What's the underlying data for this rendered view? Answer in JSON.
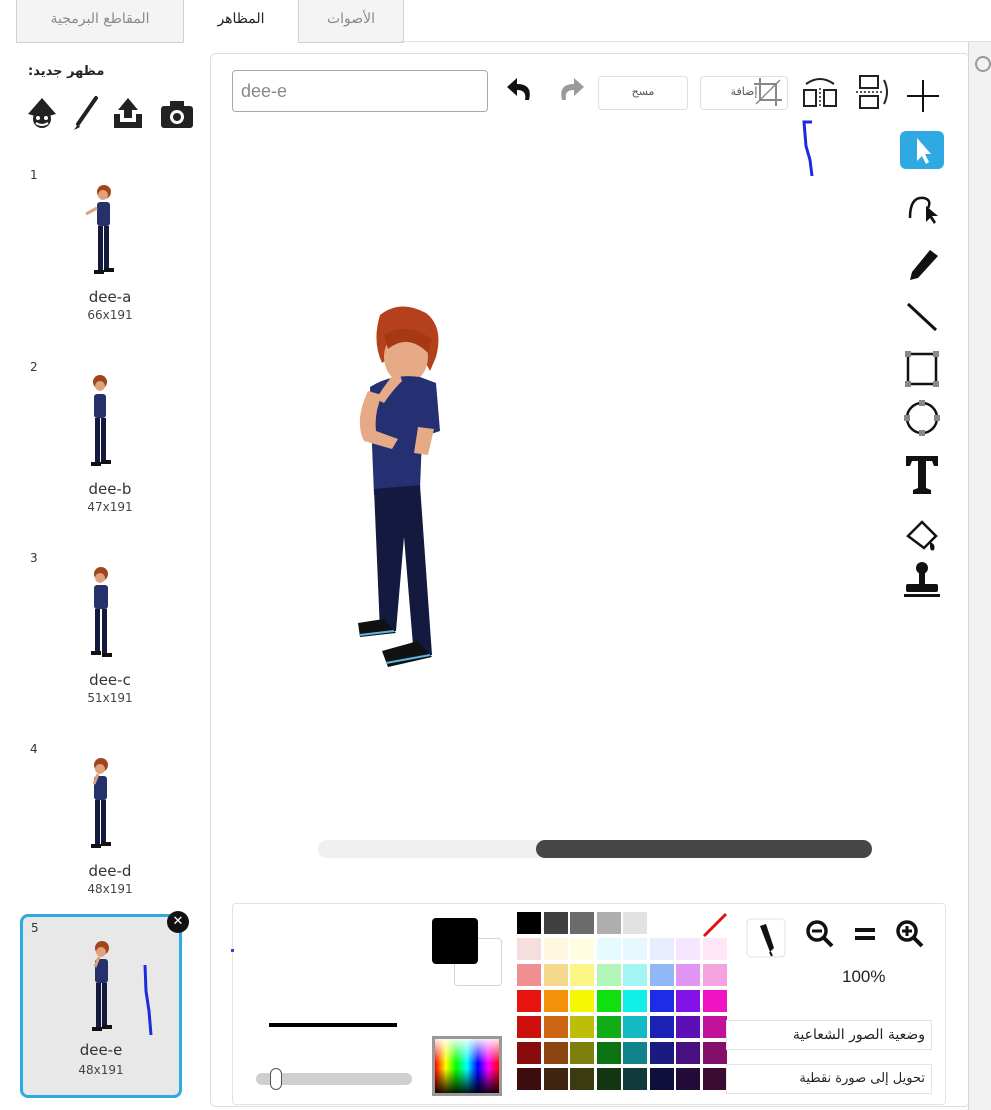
{
  "tabs": [
    {
      "label": "المقاطع البرمجية"
    },
    {
      "label": "المظاهر"
    },
    {
      "label": "الأصوات"
    }
  ],
  "new_costume": {
    "label": ":مظهر جديد",
    "icons": [
      "sprite-library-icon",
      "paint-brush-icon",
      "upload-icon",
      "camera-icon"
    ]
  },
  "costumes": [
    {
      "number": "1",
      "name": "dee-a",
      "size": "66x191"
    },
    {
      "number": "2",
      "name": "dee-b",
      "size": "47x191"
    },
    {
      "number": "3",
      "name": "dee-c",
      "size": "51x191"
    },
    {
      "number": "4",
      "name": "dee-d",
      "size": "48x191"
    },
    {
      "number": "5",
      "name": "dee-e",
      "size": "48x191",
      "selected": true
    }
  ],
  "editor": {
    "costume_name": "dee-e",
    "clear_label": "مسح",
    "add_label": "إضافة",
    "tools": [
      "select-arrow",
      "reshape",
      "pencil",
      "line",
      "rectangle",
      "ellipse",
      "text",
      "fill-bucket",
      "stamp"
    ]
  },
  "zoom": {
    "value": "100%"
  },
  "modes": {
    "bitmap_label": "وضعية الصور الشعاعية",
    "convert_label": "تحويل إلى صورة نقطية"
  },
  "colors": {
    "accent": "#2ea9e1",
    "primary_color": "#000000",
    "secondary_color": "#ffffff",
    "palette": [
      [
        "#000000",
        "#404040",
        "#6b6b6b",
        "#aeaeae",
        "#e2e2e2",
        "#ffffff",
        "#ffffff",
        "#ffffff"
      ],
      [
        "#f4dede",
        "#fff8e0",
        "#fffde0",
        "#e6fbff",
        "#e6f7ff",
        "#e8eeff",
        "#f6e6ff",
        "#ffe6f6"
      ],
      [
        "#ef8f8f",
        "#f4d98c",
        "#fbf684",
        "#b2f7b9",
        "#a3f5f4",
        "#92b7f6",
        "#e196f4",
        "#f5a3df"
      ],
      [
        "#e8140f",
        "#f3920a",
        "#f6f705",
        "#10e00d",
        "#12efe9",
        "#1d2ce7",
        "#8412e6",
        "#ef13c4"
      ],
      [
        "#cd0f0d",
        "#cb6513",
        "#bdbd0c",
        "#11ad16",
        "#13bac3",
        "#1c22b4",
        "#5d0fb6",
        "#c2119a"
      ],
      [
        "#8a0b0b",
        "#8c4410",
        "#7f7f0d",
        "#0c7312",
        "#12838a",
        "#1a1a80",
        "#480f80",
        "#830f6b"
      ],
      [
        "#3d0c0c",
        "#3f2510",
        "#3b3b0f",
        "#113611",
        "#103b3a",
        "#0f0f3b",
        "#230c3c",
        "#3b0c33"
      ]
    ]
  }
}
